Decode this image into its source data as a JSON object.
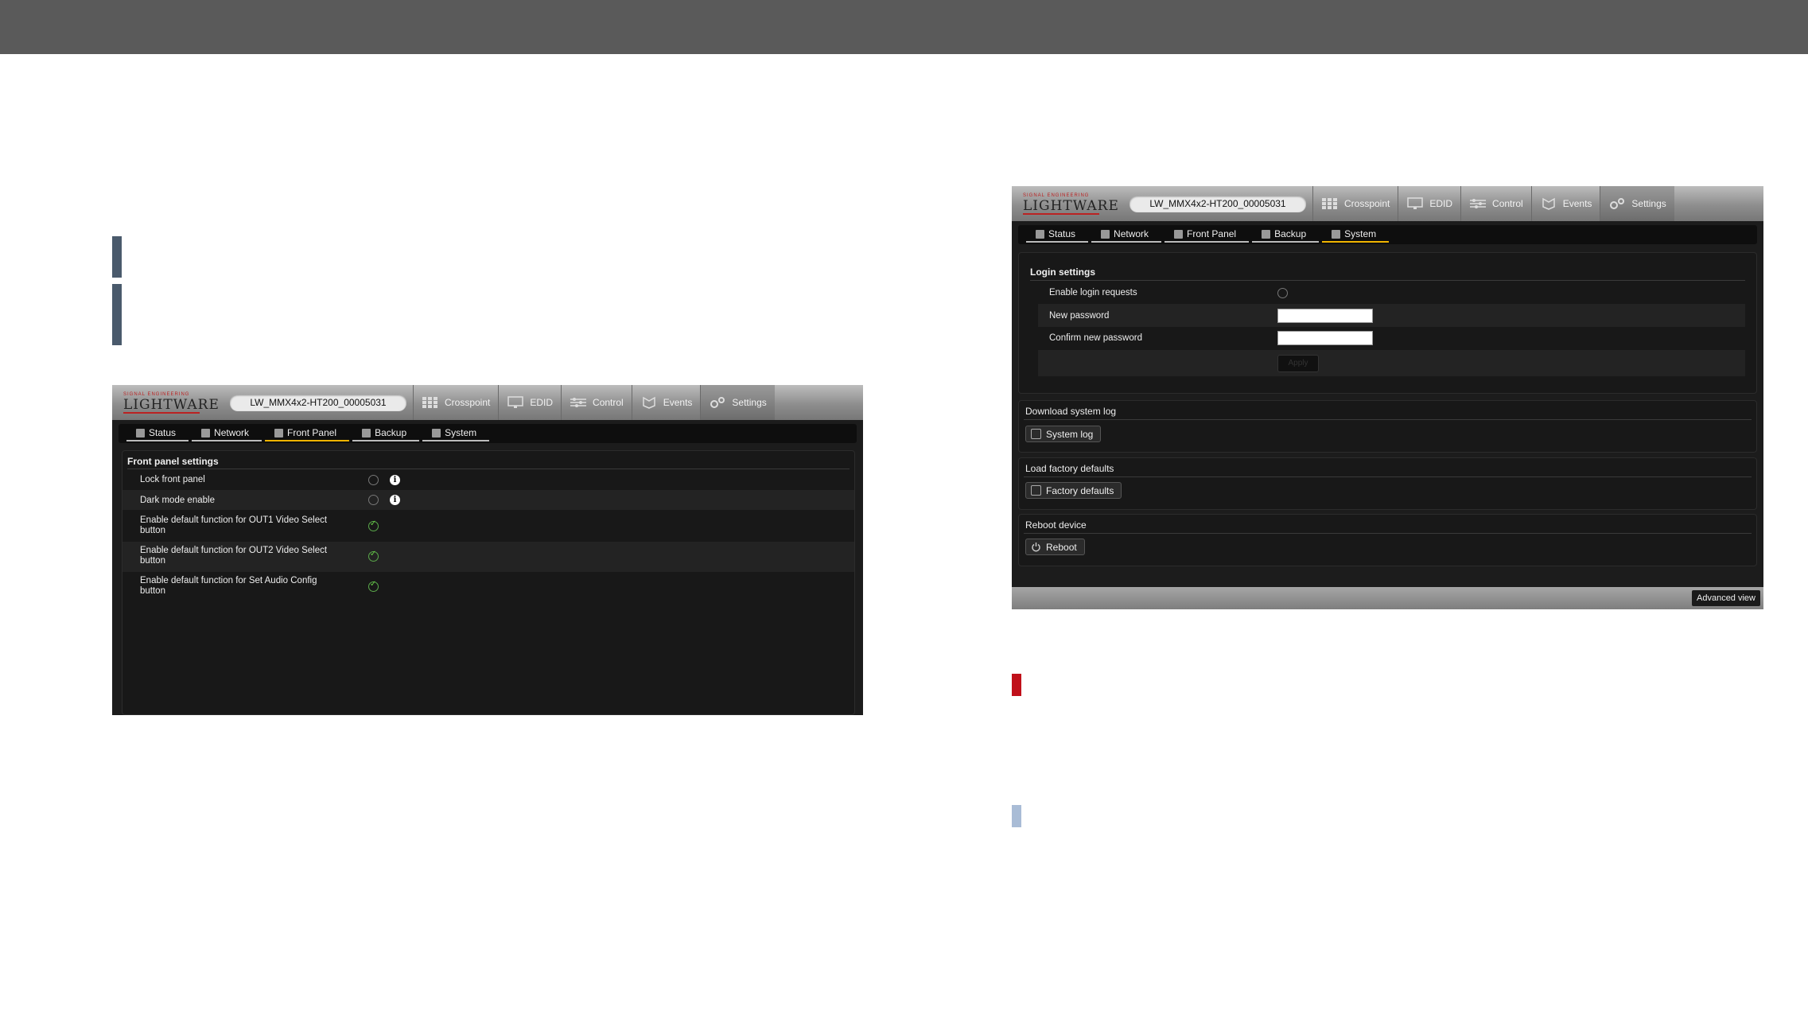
{
  "colors": {
    "topbar": "#5a5a5a",
    "marker_dark": "#4a5a6c",
    "marker_red": "#c0101a",
    "marker_light": "#a9bcd6",
    "accent_active_tab": "#f0b400"
  },
  "left_window": {
    "logo_small": "SIGNAL ENGINEERING",
    "logo_main": "LIGHTWARE",
    "device_name": "LW_MMX4x2-HT200_00005031",
    "nav": [
      {
        "label": "Crosspoint",
        "icon": "grid-icon"
      },
      {
        "label": "EDID",
        "icon": "monitor-icon"
      },
      {
        "label": "Control",
        "icon": "sliders-icon"
      },
      {
        "label": "Events",
        "icon": "events-icon"
      },
      {
        "label": "Settings",
        "icon": "gears-icon",
        "active": true
      }
    ],
    "subtabs": [
      {
        "label": "Status"
      },
      {
        "label": "Network"
      },
      {
        "label": "Front Panel",
        "active": true
      },
      {
        "label": "Backup"
      },
      {
        "label": "System"
      }
    ],
    "panel_title": "Front panel settings",
    "rows": [
      {
        "label": "Lock front panel",
        "checked": false,
        "info": "i"
      },
      {
        "label": "Dark mode enable",
        "checked": false,
        "info": "i"
      },
      {
        "label": "Enable default function for OUT1 Video Select",
        "label2": "button",
        "checked": true
      },
      {
        "label": "Enable default function for OUT2 Video Select",
        "label2": "button",
        "checked": true
      },
      {
        "label": "Enable default function for Set Audio Config",
        "label2": "button",
        "checked": true
      }
    ]
  },
  "right_window": {
    "logo_small": "SIGNAL ENGINEERING",
    "logo_main": "LIGHTWARE",
    "device_name": "LW_MMX4x2-HT200_00005031",
    "nav": [
      {
        "label": "Crosspoint",
        "icon": "grid-icon"
      },
      {
        "label": "EDID",
        "icon": "monitor-icon"
      },
      {
        "label": "Control",
        "icon": "sliders-icon"
      },
      {
        "label": "Events",
        "icon": "events-icon"
      },
      {
        "label": "Settings",
        "icon": "gears-icon",
        "active": true
      }
    ],
    "subtabs": [
      {
        "label": "Status"
      },
      {
        "label": "Network"
      },
      {
        "label": "Front Panel"
      },
      {
        "label": "Backup"
      },
      {
        "label": "System",
        "active": true
      }
    ],
    "login": {
      "title": "Login settings",
      "enable_label": "Enable login requests",
      "new_password_label": "New password",
      "confirm_password_label": "Confirm new password",
      "apply_label": "Apply"
    },
    "sections": [
      {
        "title": "Download system log",
        "button": "System log",
        "icon": "document-icon"
      },
      {
        "title": "Load factory defaults",
        "button": "Factory defaults",
        "icon": "reset-icon"
      },
      {
        "title": "Reboot device",
        "button": "Reboot",
        "icon": "power-icon"
      }
    ],
    "advanced_view": "Advanced view"
  }
}
